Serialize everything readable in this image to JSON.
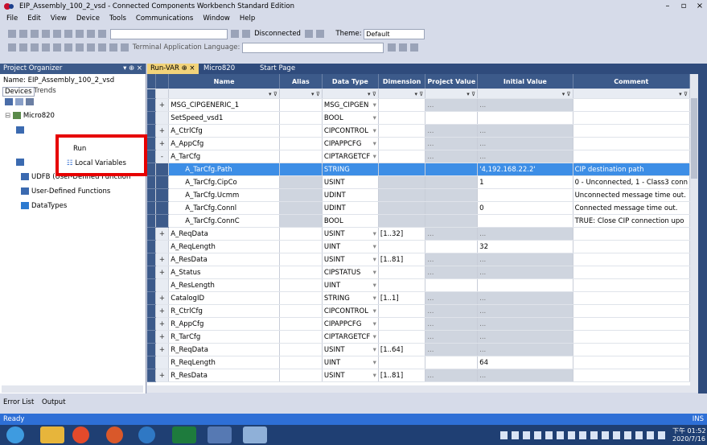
{
  "window": {
    "title": "EIP_Assembly_100_2_vsd - Connected Components Workbench Standard Edition"
  },
  "menu": [
    "File",
    "Edit",
    "View",
    "Device",
    "Tools",
    "Communications",
    "Window",
    "Help"
  ],
  "toolbar": {
    "status": "Disconnected",
    "theme_label": "Theme:",
    "theme_value": "Default",
    "terminal_label": "Terminal Application Language:"
  },
  "organizer": {
    "title": "Project Organizer",
    "name_label": "Name:  EIP_Assembly_100_2_vsd",
    "tabs": [
      "Devices",
      "Trends"
    ],
    "items": [
      "Micro820",
      "Run",
      "Local Variables",
      "UDFB (User-Defined Function",
      "User-Defined Functions",
      "DataTypes"
    ]
  },
  "tabs": [
    "Run-VAR",
    "Micro820",
    "Start Page"
  ],
  "columns": [
    "Name",
    "Alias",
    "Data Type",
    "Dimension",
    "Project Value",
    "Initial Value",
    "Comment"
  ],
  "rows": [
    {
      "ex": "+",
      "name": "MSG_CIPGENERIC_1",
      "type": "MSG_CIPGEN",
      "dd": "▾",
      "dim": "",
      "pv": "...",
      "iv": "...",
      "comment": ""
    },
    {
      "ex": "",
      "name": "SetSpeed_vsd1",
      "type": "BOOL",
      "dd": "▾",
      "dim": "",
      "pv": "",
      "iv": "",
      "comment": ""
    },
    {
      "ex": "+",
      "name": "A_CtrlCfg",
      "type": "CIPCONTROL",
      "dd": "▾",
      "dim": "",
      "pv": "...",
      "iv": "...",
      "comment": ""
    },
    {
      "ex": "+",
      "name": "A_AppCfg",
      "type": "CIPAPPCFG",
      "dd": "▾",
      "dim": "",
      "pv": "...",
      "iv": "...",
      "comment": ""
    },
    {
      "ex": "-",
      "name": "A_TarCfg",
      "type": "CIPTARGETCF",
      "dd": "▾",
      "dim": "",
      "pv": "...",
      "iv": "...",
      "comment": ""
    },
    {
      "ex": "",
      "name": "A_TarCfg.Path",
      "type": "STRING",
      "dd": "",
      "dim": "",
      "pv": "",
      "iv": "'4,192.168.22.2'",
      "comment": "CIP destination path",
      "sel": true
    },
    {
      "ex": "",
      "name": "A_TarCfg.CipCo",
      "type": "USINT",
      "dd": "",
      "dim": "",
      "pv": "",
      "iv": "1",
      "comment": "0 - Unconnected, 1 - Class3 conn"
    },
    {
      "ex": "",
      "name": "A_TarCfg.Ucmm",
      "type": "UDINT",
      "dd": "",
      "dim": "",
      "pv": "",
      "iv": "",
      "comment": "Unconnected message time out."
    },
    {
      "ex": "",
      "name": "A_TarCfg.Connl",
      "type": "UDINT",
      "dd": "",
      "dim": "",
      "pv": "",
      "iv": "0",
      "comment": "Connected message time out."
    },
    {
      "ex": "",
      "name": "A_TarCfg.ConnC",
      "type": "BOOL",
      "dd": "",
      "dim": "",
      "pv": "",
      "iv": "",
      "comment": "TRUE: Close CIP connection upo"
    },
    {
      "ex": "+",
      "name": "A_ReqData",
      "type": "USINT",
      "dd": "▾",
      "dim": "[1..32]",
      "pv": "...",
      "iv": "...",
      "comment": ""
    },
    {
      "ex": "",
      "name": "A_ReqLength",
      "type": "UINT",
      "dd": "▾",
      "dim": "",
      "pv": "",
      "iv": "32",
      "comment": ""
    },
    {
      "ex": "+",
      "name": "A_ResData",
      "type": "USINT",
      "dd": "▾",
      "dim": "[1..81]",
      "pv": "...",
      "iv": "...",
      "comment": ""
    },
    {
      "ex": "+",
      "name": "A_Status",
      "type": "CIPSTATUS",
      "dd": "▾",
      "dim": "",
      "pv": "...",
      "iv": "...",
      "comment": ""
    },
    {
      "ex": "",
      "name": "A_ResLength",
      "type": "UINT",
      "dd": "▾",
      "dim": "",
      "pv": "",
      "iv": "",
      "comment": ""
    },
    {
      "ex": "+",
      "name": "CatalogID",
      "type": "STRING",
      "dd": "▾",
      "dim": "[1..1]",
      "pv": "...",
      "iv": "...",
      "comment": ""
    },
    {
      "ex": "+",
      "name": "R_CtrlCfg",
      "type": "CIPCONTROL",
      "dd": "▾",
      "dim": "",
      "pv": "...",
      "iv": "...",
      "comment": ""
    },
    {
      "ex": "+",
      "name": "R_AppCfg",
      "type": "CIPAPPCFG",
      "dd": "▾",
      "dim": "",
      "pv": "...",
      "iv": "...",
      "comment": ""
    },
    {
      "ex": "+",
      "name": "R_TarCfg",
      "type": "CIPTARGETCF",
      "dd": "▾",
      "dim": "",
      "pv": "...",
      "iv": "...",
      "comment": ""
    },
    {
      "ex": "+",
      "name": "R_ReqData",
      "type": "USINT",
      "dd": "▾",
      "dim": "[1..64]",
      "pv": "...",
      "iv": "...",
      "comment": ""
    },
    {
      "ex": "",
      "name": "R_ReqLength",
      "type": "UINT",
      "dd": "▾",
      "dim": "",
      "pv": "",
      "iv": "64",
      "comment": ""
    },
    {
      "ex": "+",
      "name": "R_ResData",
      "type": "USINT",
      "dd": "▾",
      "dim": "[1..81]",
      "pv": "...",
      "iv": "...",
      "comment": ""
    }
  ],
  "bottom_tabs": [
    "Error List",
    "Output"
  ],
  "status": {
    "text": "Ready",
    "right": "INS"
  },
  "clock": {
    "time": "下午 01:52",
    "date": "2020/7/16"
  },
  "colors": {
    "header": "#3c5a8a",
    "selection": "#3d8ee6",
    "statusbar": "#2e6fd6",
    "highlight_box": "#e60000"
  }
}
